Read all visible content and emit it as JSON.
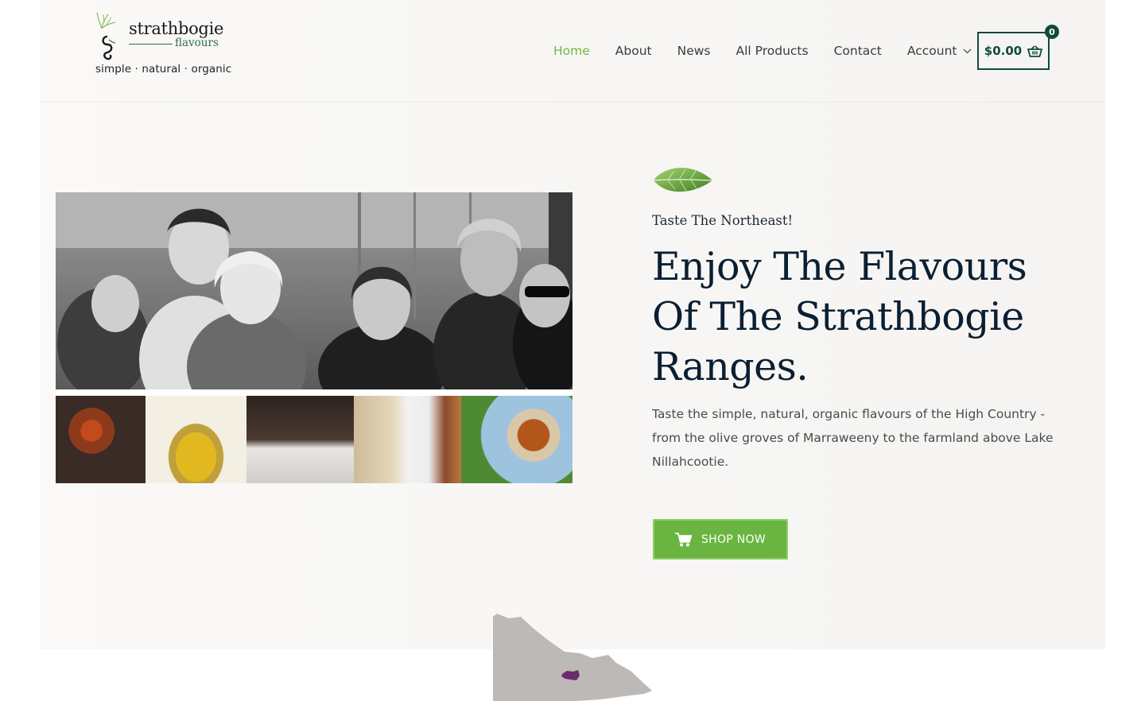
{
  "brand": {
    "name": "strathbogie",
    "sub": "flavours",
    "tagline": "simple · natural · organic"
  },
  "nav": {
    "items": [
      {
        "label": "Home",
        "active": true
      },
      {
        "label": "About",
        "active": false
      },
      {
        "label": "News",
        "active": false
      },
      {
        "label": "All Products",
        "active": false
      },
      {
        "label": "Contact",
        "active": false
      },
      {
        "label": "Account",
        "active": false,
        "has_dropdown": true
      }
    ]
  },
  "cart": {
    "total": "$0.00",
    "count": "0",
    "icon": "basket-icon"
  },
  "hero": {
    "eyebrow": "Taste The Northeast!",
    "headline": "Enjoy The Flavours Of The Strathbogie Ranges.",
    "description": "Taste the simple, natural, organic flavours of the High Country - from the olive groves of Marraweeny to the farmland above Lake Nillahcootie.",
    "cta_label": "SHOP NOW",
    "cta_icon": "cart-icon",
    "leaf_icon": "leaf-icon"
  },
  "colors": {
    "accent_green": "#6fb543",
    "button_green": "#6ab541",
    "dark_green": "#0f4b3a",
    "heading": "#0b1f33",
    "map_region": "#bdb9b6",
    "map_highlight": "#6b2c6e"
  }
}
